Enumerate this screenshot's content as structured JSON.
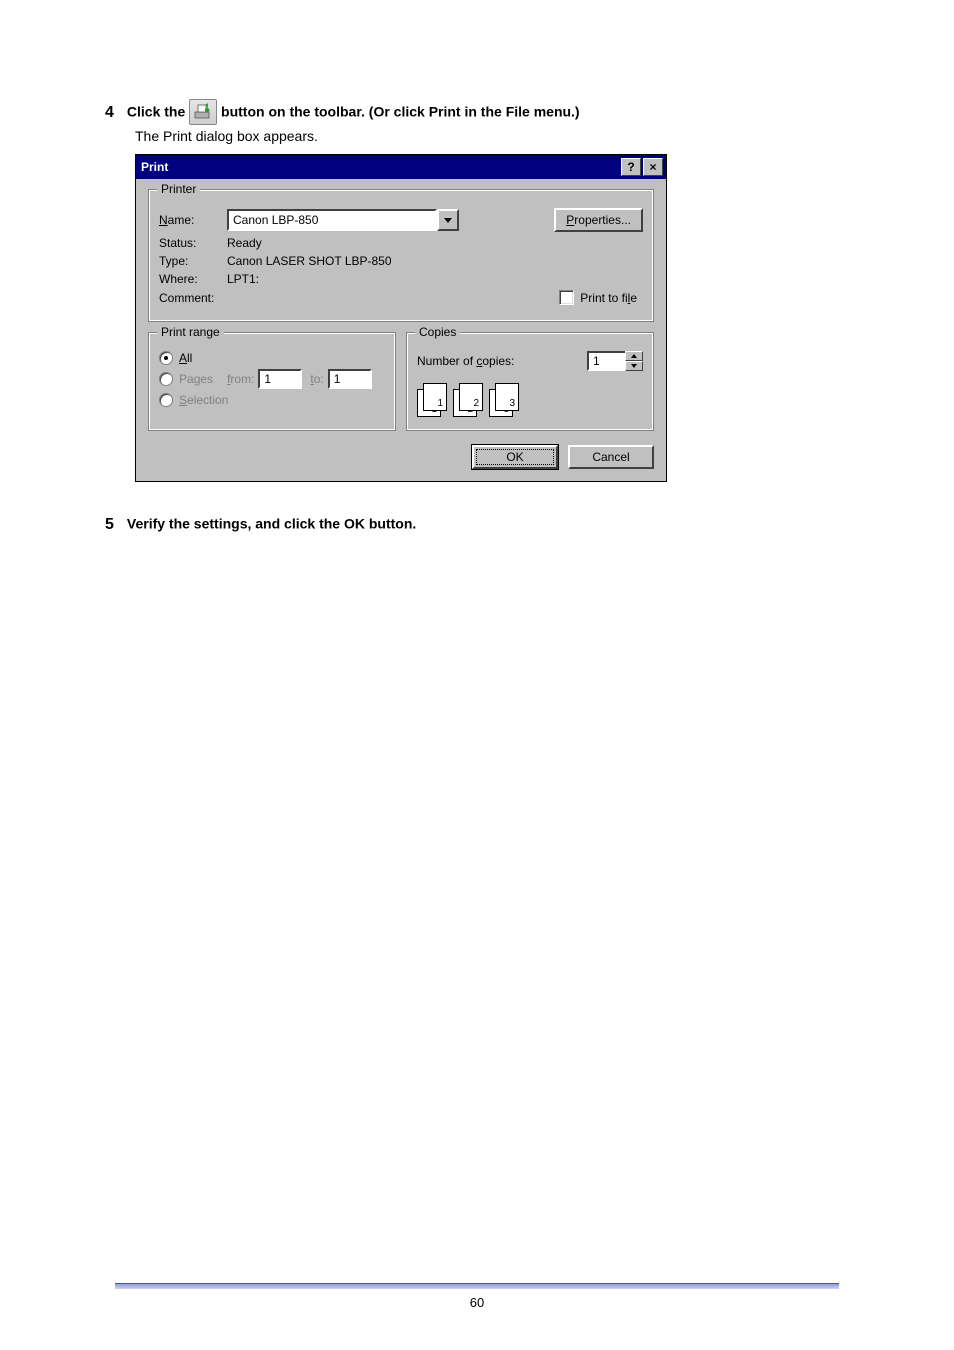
{
  "step4": {
    "number": "4",
    "prefix": "Click the ",
    "suffix": " button on the toolbar. (Or click Print in the File menu.)",
    "sub": "The Print dialog box appears."
  },
  "dialog": {
    "title": "Print",
    "printer": {
      "legend": "Printer",
      "name_label": "Name:",
      "name_value": "Canon LBP-850",
      "properties_btn": "Properties...",
      "status_label": "Status:",
      "status_value": "Ready",
      "type_label": "Type:",
      "type_value": "Canon LASER SHOT LBP-850",
      "where_label": "Where:",
      "where_value": "LPT1:",
      "comment_label": "Comment:",
      "print_to_file": "Print to file"
    },
    "range": {
      "legend": "Print range",
      "all": "All",
      "pages_label": "Pages",
      "from_label": "from:",
      "from_value": "1",
      "to_label": "to:",
      "to_value": "1",
      "selection": "Selection"
    },
    "copies": {
      "legend": "Copies",
      "number_label": "Number of copies:",
      "number_value": "1",
      "seq": [
        "1",
        "1",
        "2",
        "2",
        "3",
        "3"
      ]
    },
    "buttons": {
      "ok": "OK",
      "cancel": "Cancel"
    }
  },
  "step5": {
    "number": "5",
    "text": "Verify the settings, and click the OK button."
  },
  "page_number": "60"
}
